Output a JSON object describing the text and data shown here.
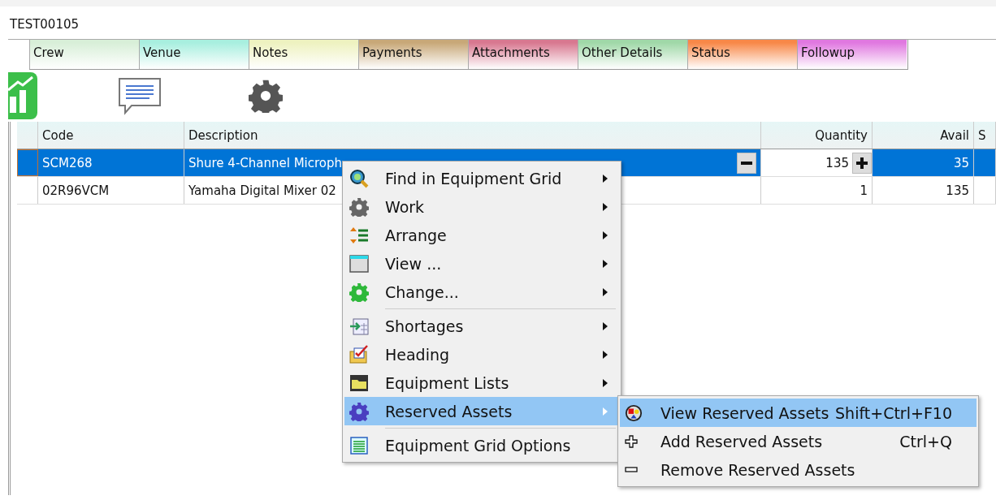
{
  "window": {
    "title": "TEST00105"
  },
  "tabs": [
    {
      "label": "Crew",
      "color": "#d8efd8"
    },
    {
      "label": "Venue",
      "color": "#a8efdf"
    },
    {
      "label": "Notes",
      "color": "#eef2c0"
    },
    {
      "label": "Payments",
      "color": "#c8a878"
    },
    {
      "label": "Attachments",
      "color": "#d87890"
    },
    {
      "label": "Other Details",
      "color": "#a0d8a8"
    },
    {
      "label": "Status",
      "color": "#f88848"
    },
    {
      "label": "Followup",
      "color": "#e078e0"
    }
  ],
  "grid": {
    "columns": [
      "Code",
      "Description",
      "Quantity",
      "Avail",
      "S"
    ],
    "rows": [
      {
        "code": "SCM268",
        "description": "Shure 4-Channel Microph",
        "quantity": "135",
        "avail": "35",
        "selected": true
      },
      {
        "code": "02R96VCM",
        "description": "Yamaha Digital Mixer 02",
        "quantity": "1",
        "avail": "135",
        "selected": false
      }
    ]
  },
  "context_menu": {
    "groups": [
      [
        {
          "label": "Find in Equipment Grid",
          "submenu": true,
          "selected": false
        },
        {
          "label": "Work",
          "submenu": true,
          "selected": false
        },
        {
          "label": "Arrange",
          "submenu": true,
          "selected": false
        },
        {
          "label": "View ...",
          "submenu": true,
          "selected": false
        },
        {
          "label": "Change...",
          "submenu": true,
          "selected": false
        }
      ],
      [
        {
          "label": "Shortages",
          "submenu": true,
          "selected": false
        },
        {
          "label": "Heading",
          "submenu": true,
          "selected": false
        },
        {
          "label": "Equipment Lists",
          "submenu": true,
          "selected": false
        },
        {
          "label": "Reserved Assets",
          "submenu": true,
          "selected": true
        }
      ],
      [
        {
          "label": "Equipment Grid Options",
          "submenu": false,
          "selected": false
        }
      ]
    ]
  },
  "submenu": {
    "items": [
      {
        "label": "View Reserved Assets",
        "shortcut": "Shift+Ctrl+F10",
        "selected": true
      },
      {
        "label": "Add Reserved Assets",
        "shortcut": "Ctrl+Q",
        "selected": false
      },
      {
        "label": "Remove Reserved Assets",
        "selected": false
      }
    ]
  }
}
